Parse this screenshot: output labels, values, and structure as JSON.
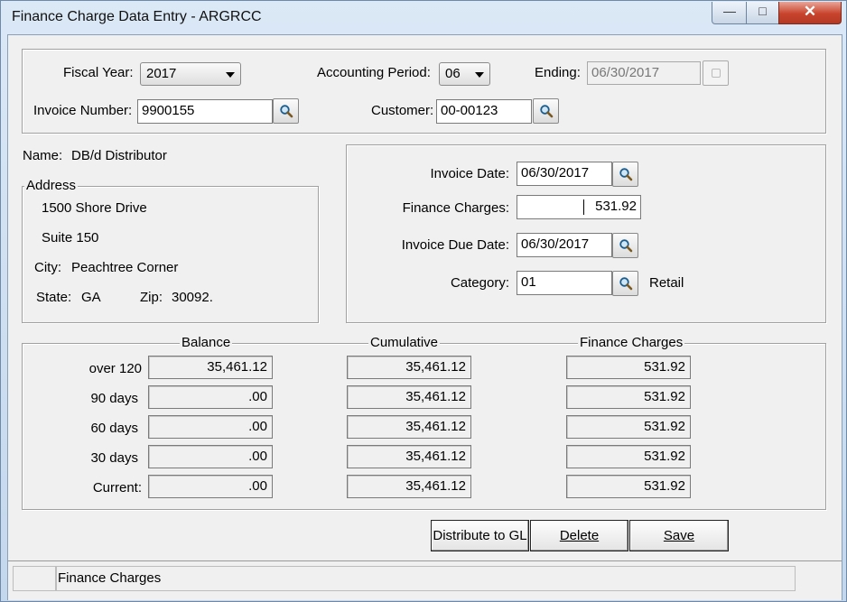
{
  "window": {
    "title": "Finance Charge Data Entry - ARGRCC"
  },
  "header": {
    "fiscal_year_label": "Fiscal Year:",
    "fiscal_year_value": "2017",
    "accounting_period_label": "Accounting Period:",
    "accounting_period_value": "06",
    "ending_label": "Ending:",
    "ending_value": "06/30/2017",
    "invoice_number_label": "Invoice Number:",
    "invoice_number_value": "9900155",
    "customer_label": "Customer:",
    "customer_value": "00-00123"
  },
  "customer": {
    "name_label": "Name:",
    "name_value": "DB/d Distributor",
    "address_legend": "Address",
    "address_line1": "1500 Shore Drive",
    "address_line2": "Suite 150",
    "city_label": "City:",
    "city_value": "Peachtree Corner",
    "state_label": "State:",
    "state_value": "GA",
    "zip_label": "Zip:",
    "zip_value": "30092."
  },
  "invoice": {
    "invoice_date_label": "Invoice Date:",
    "invoice_date_value": "06/30/2017",
    "finance_charges_label": "Finance Charges:",
    "finance_charges_value": "531.92",
    "due_date_label": "Invoice Due Date:",
    "due_date_value": "06/30/2017",
    "category_label": "Category:",
    "category_value": "01",
    "category_desc": "Retail"
  },
  "aging": {
    "col_balance": "Balance",
    "col_cumulative": "Cumulative",
    "col_finance": "Finance Charges",
    "rows": [
      {
        "label": "over 120",
        "balance": "35,461.12",
        "cumulative": "35,461.12",
        "finance": "531.92"
      },
      {
        "label": "90 days",
        "balance": ".00",
        "cumulative": "35,461.12",
        "finance": "531.92"
      },
      {
        "label": "60 days",
        "balance": ".00",
        "cumulative": "35,461.12",
        "finance": "531.92"
      },
      {
        "label": "30 days",
        "balance": ".00",
        "cumulative": "35,461.12",
        "finance": "531.92"
      },
      {
        "label": "Current:",
        "balance": ".00",
        "cumulative": "35,461.12",
        "finance": "531.92"
      }
    ]
  },
  "buttons": {
    "distribute_label": "Distribute to GL",
    "delete_label": "Delete",
    "save_label": "Save"
  },
  "status": {
    "text": "Finance Charges"
  },
  "icons": {
    "lookup": "magnifier-icon",
    "calendar": "calendar-icon",
    "dropdown": "chevron-down-icon"
  },
  "colors": {
    "title_gradient_top": "#dbe8f6",
    "close_button": "#c9432c",
    "panel_bg": "#f0f0f0"
  }
}
